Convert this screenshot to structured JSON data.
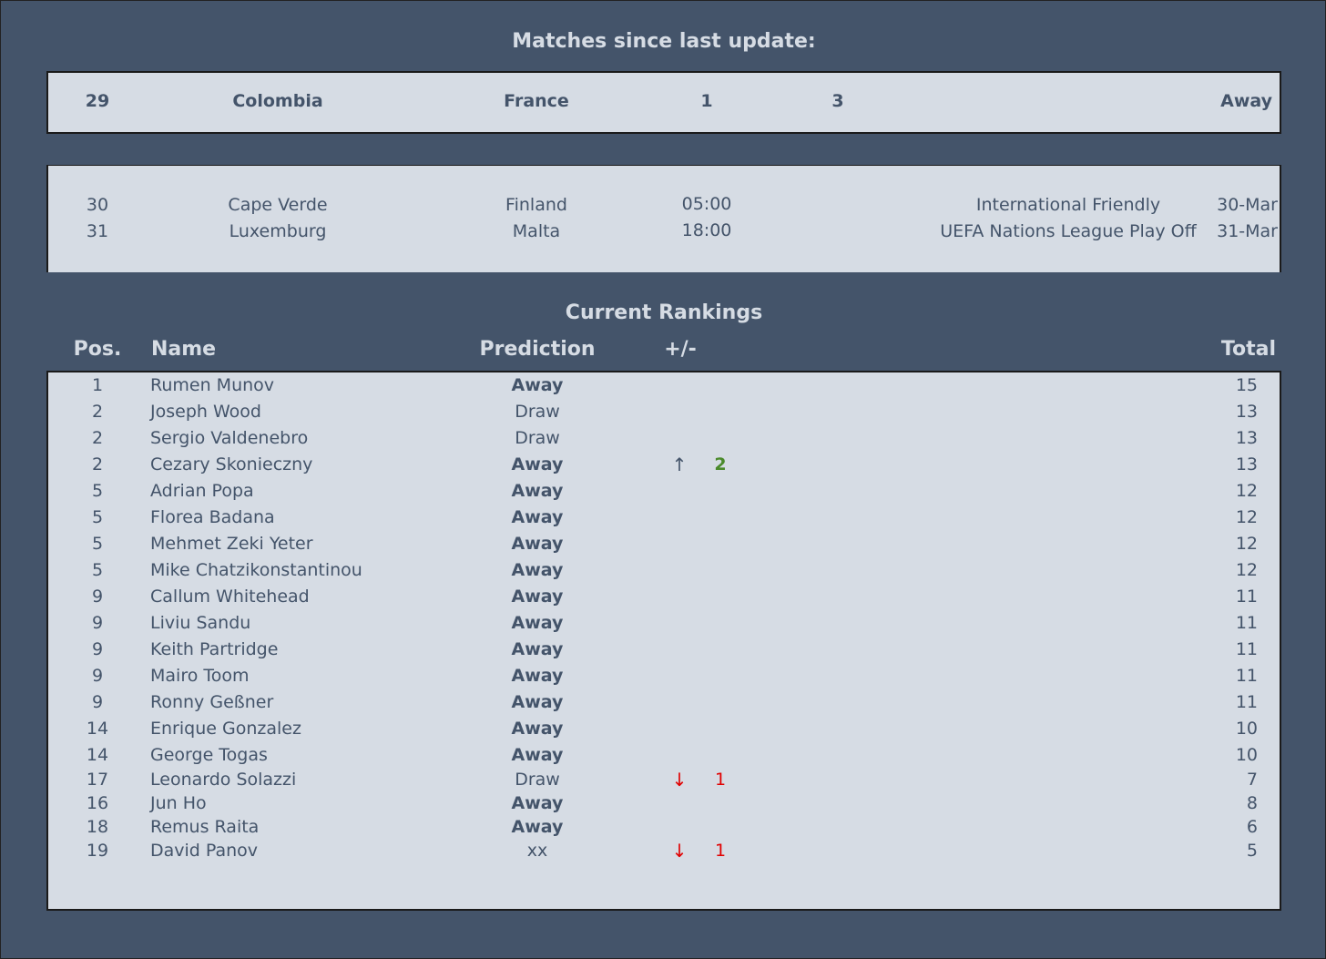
{
  "sections": {
    "matches_title": "Matches since last update:",
    "rankings_title": "Current Rankings"
  },
  "last_match": {
    "num": "29",
    "home": "Colombia",
    "away": "France",
    "home_goals": "1",
    "away_goals": "3",
    "result": "Away"
  },
  "upcoming": [
    {
      "num": "30",
      "home": "Cape Verde",
      "away": "Finland",
      "time": "05:00",
      "competition": "International Friendly",
      "date": "30-Mar"
    },
    {
      "num": "31",
      "home": "Luxemburg",
      "away": "Malta",
      "time": "18:00",
      "competition": "UEFA Nations League Play Off",
      "date": "31-Mar"
    }
  ],
  "table_headers": {
    "pos": "Pos.",
    "name": "Name",
    "prediction": "Prediction",
    "change": "+/-",
    "total": "Total"
  },
  "rankings": [
    {
      "pos": "1",
      "name": "Rumen Munov",
      "prediction": "Away",
      "arrow": "",
      "delta": "",
      "total": "15"
    },
    {
      "pos": "2",
      "name": "Joseph Wood",
      "prediction": "Draw",
      "arrow": "",
      "delta": "",
      "total": "13"
    },
    {
      "pos": "2",
      "name": "Sergio Valdenebro",
      "prediction": "Draw",
      "arrow": "",
      "delta": "",
      "total": "13"
    },
    {
      "pos": "2",
      "name": "Cezary Skonieczny",
      "prediction": "Away",
      "arrow": "↑",
      "delta": "2",
      "total": "13"
    },
    {
      "pos": "5",
      "name": "Adrian Popa",
      "prediction": "Away",
      "arrow": "",
      "delta": "",
      "total": "12"
    },
    {
      "pos": "5",
      "name": "Florea Badana",
      "prediction": "Away",
      "arrow": "",
      "delta": "",
      "total": "12"
    },
    {
      "pos": "5",
      "name": "Mehmet Zeki Yeter",
      "prediction": "Away",
      "arrow": "",
      "delta": "",
      "total": "12"
    },
    {
      "pos": "5",
      "name": "Mike Chatzikonstantinou",
      "prediction": "Away",
      "arrow": "",
      "delta": "",
      "total": "12"
    },
    {
      "pos": "9",
      "name": "Callum Whitehead",
      "prediction": "Away",
      "arrow": "",
      "delta": "",
      "total": "11"
    },
    {
      "pos": "9",
      "name": "Liviu Sandu",
      "prediction": "Away",
      "arrow": "",
      "delta": "",
      "total": "11"
    },
    {
      "pos": "9",
      "name": "Keith Partridge",
      "prediction": "Away",
      "arrow": "",
      "delta": "",
      "total": "11"
    },
    {
      "pos": "9",
      "name": "Mairo Toom",
      "prediction": "Away",
      "arrow": "",
      "delta": "",
      "total": "11"
    },
    {
      "pos": "9",
      "name": "Ronny Geßner",
      "prediction": "Away",
      "arrow": "",
      "delta": "",
      "total": "11"
    },
    {
      "pos": "14",
      "name": "Enrique Gonzalez",
      "prediction": "Away",
      "arrow": "",
      "delta": "",
      "total": "10"
    },
    {
      "pos": "14",
      "name": "George Togas",
      "prediction": "Away",
      "arrow": "",
      "delta": "",
      "total": "10"
    },
    {
      "pos": "17",
      "name": "Leonardo Solazzi",
      "prediction": "Draw",
      "arrow": "↓",
      "delta": "1",
      "total": "7"
    },
    {
      "pos": "16",
      "name": "Jun Ho",
      "prediction": "Away",
      "arrow": "",
      "delta": "",
      "total": "8"
    },
    {
      "pos": "18",
      "name": "Remus Raita",
      "prediction": "Away",
      "arrow": "",
      "delta": "",
      "total": "6"
    },
    {
      "pos": "19",
      "name": "David Panov",
      "prediction": "xx",
      "arrow": "↓",
      "delta": "1",
      "total": "5"
    }
  ],
  "colors": {
    "background": "#44546a",
    "panel": "#d6dce4",
    "up": "#4a8a2a",
    "down": "#e00000"
  }
}
